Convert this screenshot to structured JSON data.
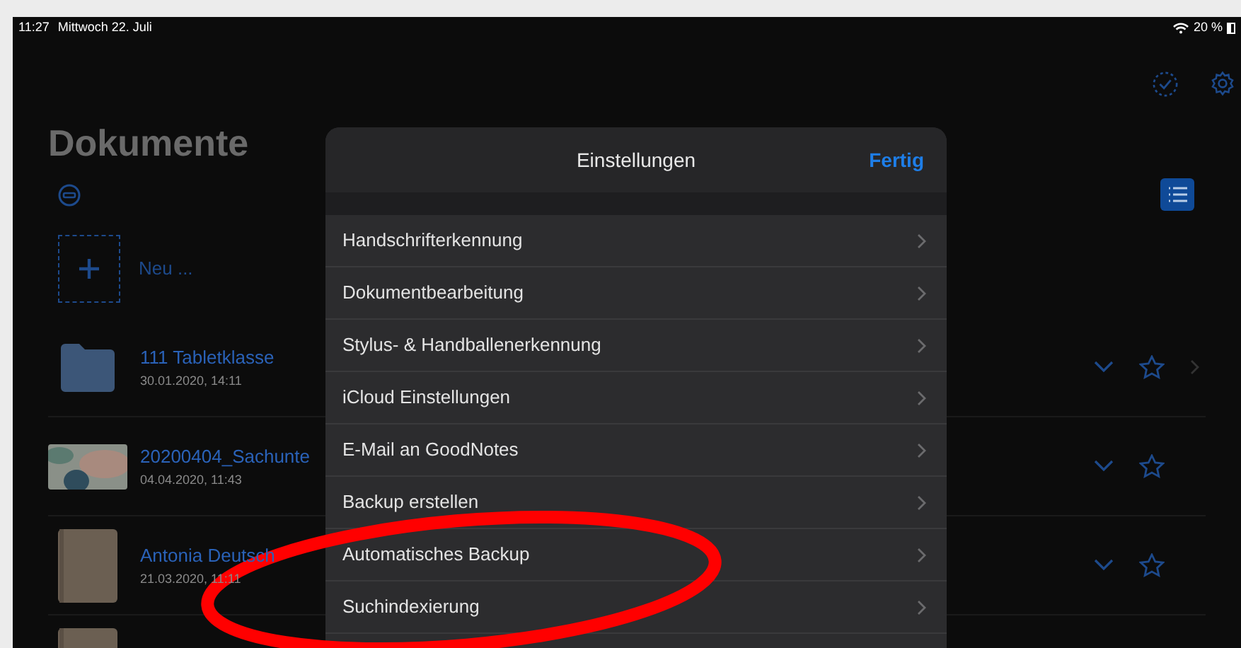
{
  "status_bar": {
    "time": "11:27",
    "date": "Mittwoch 22. Juli",
    "battery": "20 %"
  },
  "library": {
    "title": "Dokumente",
    "new_label": "Neu ...",
    "documents": [
      {
        "kind": "folder",
        "name": "111 Tabletklasse",
        "date": "30.01.2020, 14:11",
        "has_arrow": true
      },
      {
        "kind": "image",
        "name": "20200404_Sachunte",
        "date": "04.04.2020, 11:43",
        "has_arrow": false
      },
      {
        "kind": "notebook",
        "name": "Antonia Deutsch",
        "date": "21.03.2020, 11:11",
        "has_arrow": false
      },
      {
        "kind": "notebook"
      }
    ]
  },
  "settings": {
    "title": "Einstellungen",
    "done": "Fertig",
    "items": [
      {
        "label": "Handschrifterkennung"
      },
      {
        "label": "Dokumentbearbeitung"
      },
      {
        "label": "Stylus- & Handballenerkennung"
      },
      {
        "label": "iCloud Einstellungen"
      },
      {
        "label": "E-Mail an GoodNotes"
      },
      {
        "label": "Backup erstellen"
      },
      {
        "label": "Automatisches Backup"
      },
      {
        "label": "Suchindexierung"
      }
    ]
  }
}
